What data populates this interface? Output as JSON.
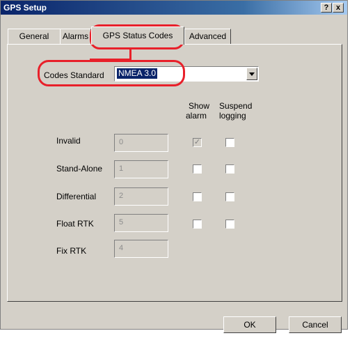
{
  "window": {
    "title": "GPS Setup",
    "help_glyph": "?",
    "close_glyph": "x"
  },
  "tabs": [
    {
      "label": "General"
    },
    {
      "label": "Alarms"
    },
    {
      "label": "GPS Status Codes",
      "active": true
    },
    {
      "label": "Advanced"
    }
  ],
  "codes_standard": {
    "label": "Codes Standard",
    "value": "NMEA 3.0"
  },
  "headers": {
    "show_alarm_line1": "Show",
    "show_alarm_line2": "alarm",
    "suspend_line1": "Suspend",
    "suspend_line2": "logging"
  },
  "rows": [
    {
      "label": "Invalid",
      "code": "0",
      "show_alarm": true,
      "show_alarm_disabled": true,
      "suspend": false
    },
    {
      "label": "Stand-Alone",
      "code": "1",
      "show_alarm": false,
      "suspend": false
    },
    {
      "label": "Differential",
      "code": "2",
      "show_alarm": false,
      "suspend": false
    },
    {
      "label": "Float RTK",
      "code": "5",
      "show_alarm": false,
      "suspend": false
    },
    {
      "label": "Fix RTK",
      "code": "4"
    }
  ],
  "buttons": {
    "ok": "OK",
    "cancel": "Cancel"
  },
  "colors": {
    "highlight": "#e8202a",
    "title_bar": "#0a246a",
    "dialog_face": "#d4d0c8"
  }
}
